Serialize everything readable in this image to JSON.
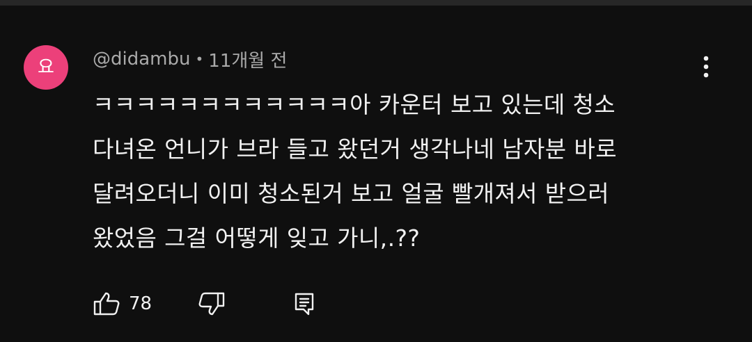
{
  "comment": {
    "avatar_initial": "요",
    "avatar_color": "#ec407a",
    "author": "@didambu",
    "separator": "•",
    "timestamp": "11개월 전",
    "text_lines": [
      "ㅋㅋㅋㅋㅋㅋㅋㅋㅋㅋㅋㅋ아 카운터 보고 있는데 청소",
      "다녀온 언니가 브라 들고 왔던거 생각나네 남자분 바로",
      "달려오더니 이미 청소된거 보고 얼굴 빨개져서 받으러",
      "왔었음 그걸 어떻게 잊고 가니,.??"
    ],
    "like_count": "78"
  },
  "icons": {
    "menu": "more-vert-icon",
    "like": "thumb-up-icon",
    "dislike": "thumb-down-icon",
    "reply": "reply-comment-icon"
  }
}
